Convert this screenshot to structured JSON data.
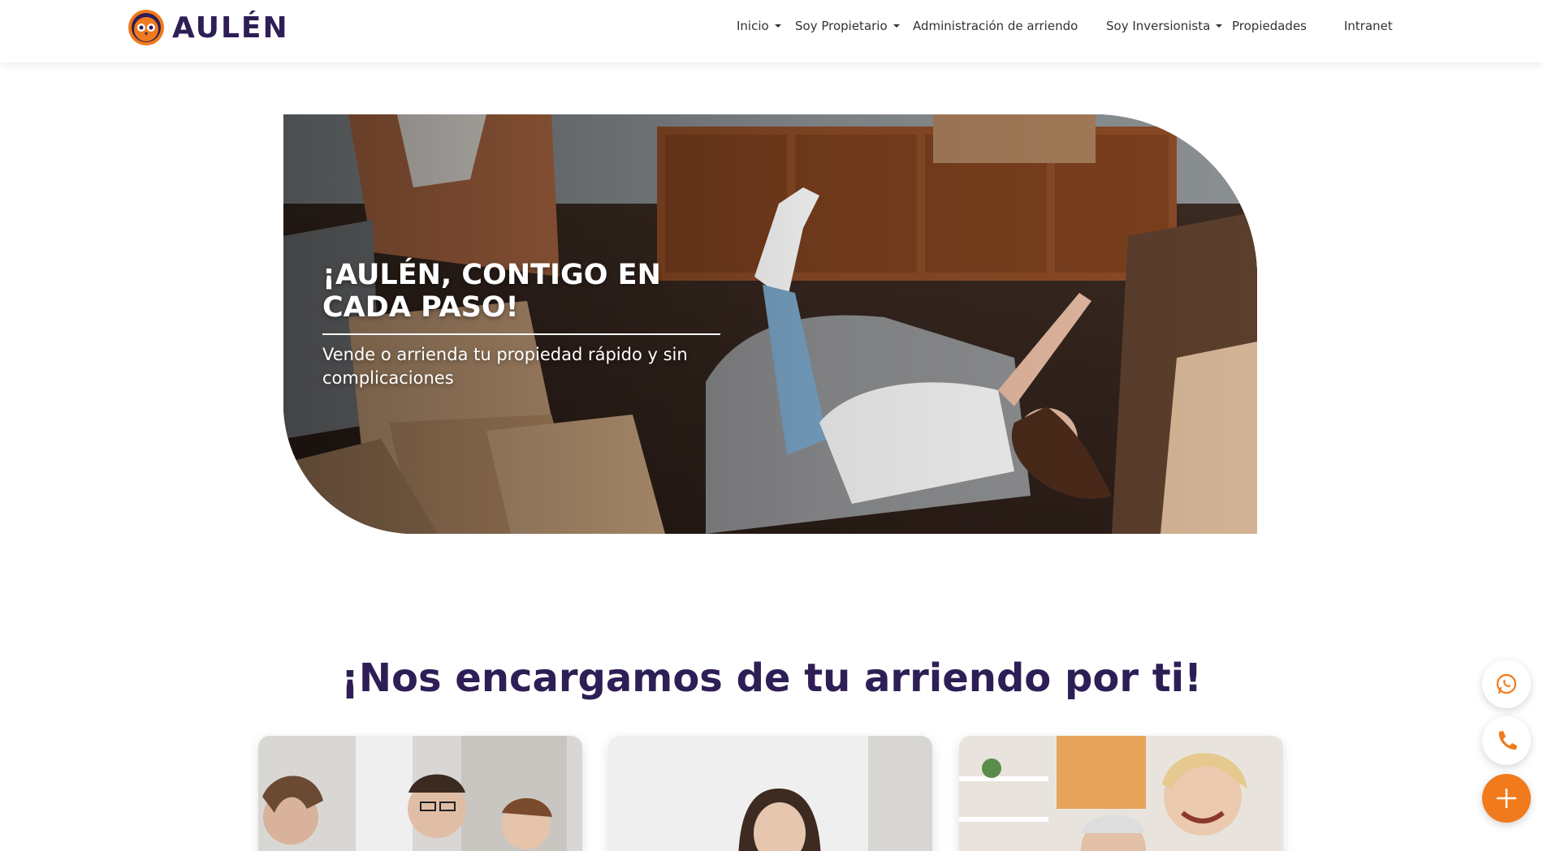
{
  "brand": {
    "name": "AULÉN",
    "colors": {
      "primary": "#2e1e56",
      "accent": "#f07a1c"
    }
  },
  "nav": {
    "items": [
      {
        "label": "Inicio",
        "has_dropdown": true
      },
      {
        "label": "Soy Propietario",
        "has_dropdown": true
      },
      {
        "label": "Administración de arriendo",
        "has_dropdown": false
      },
      {
        "label": "Soy Inversionista",
        "has_dropdown": true
      },
      {
        "label": "Propiedades",
        "has_dropdown": false
      },
      {
        "label": "Intranet",
        "has_dropdown": false
      }
    ]
  },
  "hero": {
    "title": "¡AULÉN, CONTIGO EN CADA PASO!",
    "subtitle": "Vende o arrienda tu propiedad rápido y sin complicaciones"
  },
  "section": {
    "title": "¡Nos encargamos de tu arriendo por ti!"
  },
  "floating_actions": {
    "icons": [
      "whatsapp-icon",
      "phone-icon",
      "plus-icon"
    ]
  }
}
